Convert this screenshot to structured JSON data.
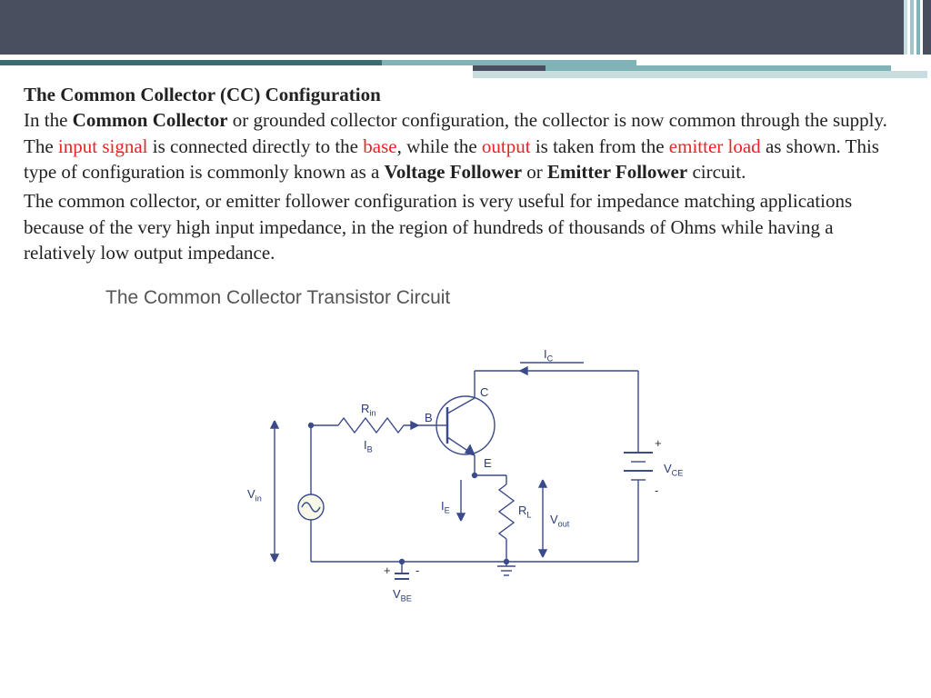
{
  "header": {
    "title": "The Common Collector (CC) Configuration"
  },
  "paragraph1": {
    "t1": "In the ",
    "bold1": "Common Collector",
    "t2": " or grounded collector configuration, the collector is now common through the supply. The ",
    "red1": "input signal",
    "t3": " is connected directly to the ",
    "red2": "base",
    "t4": ", while the ",
    "red3": "output",
    "t5": " is taken from the ",
    "red4": "emitter load",
    "t6": " as shown. This type of configuration is commonly known as a ",
    "bold2": "Voltage Follower",
    "t7": " or ",
    "bold3": "Emitter Follower",
    "t8": " circuit."
  },
  "paragraph2": "The common collector, or emitter follower configuration is very useful for impedance matching applications because of the very high input impedance, in the region of hundreds of thousands of Ohms while having a relatively low output impedance.",
  "diagram": {
    "title": "The Common Collector Transistor Circuit",
    "labels": {
      "ic": "I",
      "ic_sub": "C",
      "rin": "R",
      "rin_sub": "in",
      "b": "B",
      "c": "C",
      "e": "E",
      "ib": "I",
      "ib_sub": "B",
      "ie": "I",
      "ie_sub": "E",
      "rl": "R",
      "rl_sub": "L",
      "vin": "V",
      "vin_sub": "in",
      "vout": "V",
      "vout_sub": "out",
      "vce": "V",
      "vce_sub": "CE",
      "vbe": "V",
      "vbe_sub": "BE",
      "plus": "+",
      "minus": "-"
    }
  }
}
